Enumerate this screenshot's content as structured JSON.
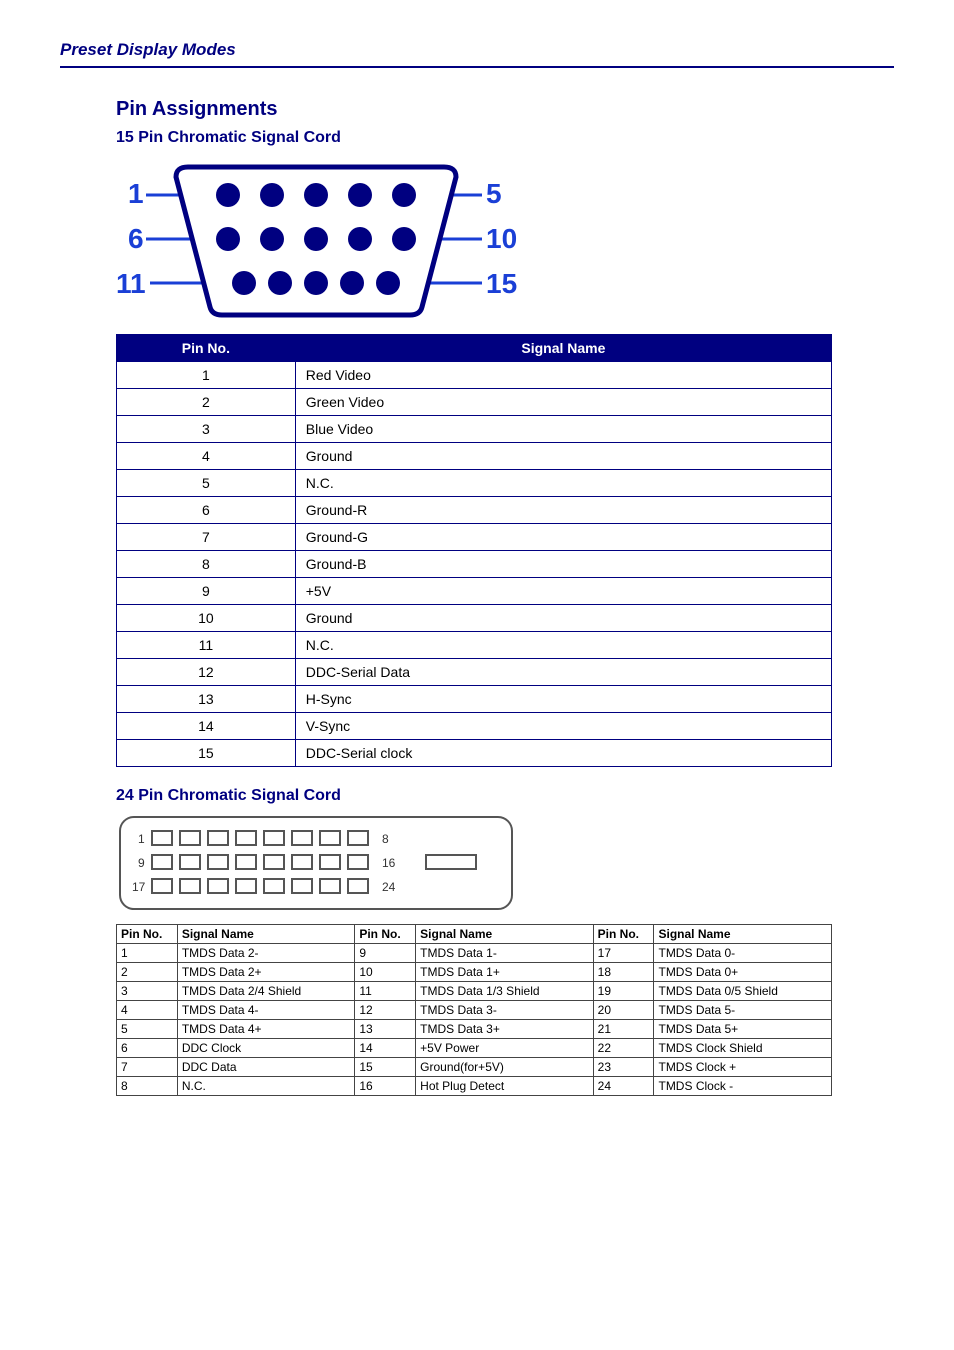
{
  "header": {
    "title": "Preset Display Modes"
  },
  "vga": {
    "title": "Pin Assignments",
    "subtitle": "15 Pin Chromatic Signal Cord",
    "headers": {
      "pin": "Pin No.",
      "signal": "Signal Name"
    },
    "rows": [
      {
        "pin": "1",
        "signal": "Red Video"
      },
      {
        "pin": "2",
        "signal": "Green Video"
      },
      {
        "pin": "3",
        "signal": "Blue Video"
      },
      {
        "pin": "4",
        "signal": "Ground"
      },
      {
        "pin": "5",
        "signal": "N.C."
      },
      {
        "pin": "6",
        "signal": "Ground-R"
      },
      {
        "pin": "7",
        "signal": "Ground-G"
      },
      {
        "pin": "8",
        "signal": "Ground-B"
      },
      {
        "pin": "9",
        "signal": "+5V"
      },
      {
        "pin": "10",
        "signal": "Ground"
      },
      {
        "pin": "11",
        "signal": "N.C."
      },
      {
        "pin": "12",
        "signal": "DDC-Serial Data"
      },
      {
        "pin": "13",
        "signal": "H-Sync"
      },
      {
        "pin": "14",
        "signal": "V-Sync"
      },
      {
        "pin": "15",
        "signal": "DDC-Serial clock"
      }
    ]
  },
  "dvi": {
    "subtitle": "24 Pin Chromatic Signal Cord",
    "headers": {
      "pin": "Pin No.",
      "signal": "Signal Name"
    },
    "rows": [
      {
        "p1": "1",
        "s1": "TMDS Data 2-",
        "p2": "9",
        "s2": "TMDS Data 1-",
        "p3": "17",
        "s3": "TMDS Data 0-"
      },
      {
        "p1": "2",
        "s1": "TMDS Data 2+",
        "p2": "10",
        "s2": "TMDS Data 1+",
        "p3": "18",
        "s3": "TMDS Data 0+"
      },
      {
        "p1": "3",
        "s1": "TMDS Data 2/4 Shield",
        "p2": "11",
        "s2": "TMDS Data 1/3 Shield",
        "p3": "19",
        "s3": "TMDS Data 0/5 Shield"
      },
      {
        "p1": "4",
        "s1": "TMDS Data 4-",
        "p2": "12",
        "s2": "TMDS Data 3-",
        "p3": "20",
        "s3": "TMDS Data 5-"
      },
      {
        "p1": "5",
        "s1": "TMDS Data 4+",
        "p2": "13",
        "s2": "TMDS Data 3+",
        "p3": "21",
        "s3": "TMDS Data 5+"
      },
      {
        "p1": "6",
        "s1": "DDC Clock",
        "p2": "14",
        "s2": "+5V Power",
        "p3": "22",
        "s3": "TMDS Clock Shield"
      },
      {
        "p1": "7",
        "s1": "DDC Data",
        "p2": "15",
        "s2": "Ground(for+5V)",
        "p3": "23",
        "s3": "TMDS Clock +"
      },
      {
        "p1": "8",
        "s1": "N.C.",
        "p2": "16",
        "s2": "Hot Plug Detect",
        "p3": "24",
        "s3": "TMDS Clock -"
      }
    ]
  },
  "vga_diagram_labels": {
    "l1": "1",
    "l6": "6",
    "l11": "11",
    "r5": "5",
    "r10": "10",
    "r15": "15"
  },
  "dvi_diagram_labels": {
    "l1": "1",
    "l9": "9",
    "l17": "17",
    "r8": "8",
    "r16": "16",
    "r24": "24"
  }
}
